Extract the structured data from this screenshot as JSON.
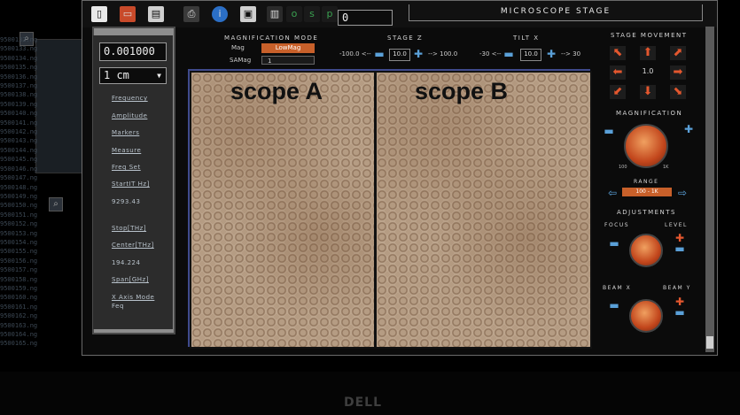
{
  "background": {
    "list_items": [
      "9500132.ng",
      "9500133.ng",
      "9500134.ng",
      "9500135.ng",
      "9500136.ng",
      "9500137.ng",
      "9500138.ng",
      "9500139.ng",
      "9500140.ng",
      "9500141.ng",
      "9500142.ng",
      "9500143.ng",
      "9500144.ng",
      "9500145.ng",
      "9500146.ng",
      "9500147.ng",
      "9500148.ng",
      "9500149.ng",
      "9500150.ng",
      "9500151.ng",
      "9500152.ng",
      "9500153.ng",
      "9500154.ng",
      "9500155.ng",
      "9500156.ng",
      "9500157.ng",
      "9500158.ng",
      "9500159.ng",
      "9500160.ng",
      "9500161.ng",
      "9500162.ng",
      "9500163.ng",
      "9500164.ng",
      "9500165.ng"
    ]
  },
  "toolbar": {
    "counter_value": "0",
    "stage_title": "MICROSCOPE STAGE",
    "magnification_mode_label": "MAGNIFICATION MODE",
    "mag_label": "Mag",
    "samag_label": "SAMag",
    "mode_value": "LowMag",
    "samag_value": "1",
    "stage_z_label": "STAGE Z",
    "stage_z_min": "-100.0 <--",
    "stage_z_value": "10.0",
    "stage_z_max": "--> 100.0",
    "tilt_x_label": "TILT X",
    "tilt_x_min": "-30 <--",
    "tilt_x_value": "10.0",
    "tilt_x_max": "--> 30"
  },
  "left_panel": {
    "value_field": "0.001000",
    "unit_select": "1 cm",
    "items": [
      {
        "label": "Frequency",
        "kind": "link"
      },
      {
        "label": "Amplitude",
        "kind": "link"
      },
      {
        "label": "Markers",
        "kind": "link"
      },
      {
        "label": "Measure",
        "kind": "link"
      },
      {
        "label": "Freq Set",
        "kind": "link"
      },
      {
        "label": "StartIT Hz]",
        "kind": "link"
      },
      {
        "label": "9293.43",
        "kind": "value"
      },
      {
        "label": "Stop[THz]",
        "kind": "link"
      },
      {
        "label": "Center[THz]",
        "kind": "link"
      },
      {
        "label": "194.224",
        "kind": "value"
      },
      {
        "label": "Span[GHz]",
        "kind": "link"
      },
      {
        "label": "X Axis Mode",
        "kind": "link"
      },
      {
        "label": "Feq",
        "kind": "value"
      }
    ]
  },
  "viewport": {
    "scope_a": "scope A",
    "scope_b": "scope B"
  },
  "right_panel": {
    "stage_movement_label": "STAGE MOVEMENT",
    "step_value": "1.0",
    "magnification_label": "MAGNIFICATION",
    "dial_min": "100",
    "dial_max": "1K",
    "range_label": "RANGE",
    "range_value": "100 - 1K",
    "adjustments_label": "ADJUSTMENTS",
    "focus_label": "FOCUS",
    "level_label": "LEVEL",
    "beam_x_label": "BEAM X",
    "beam_y_label": "BEAM Y"
  },
  "monitor": {
    "brand": "DELL"
  },
  "colors": {
    "accent_orange": "#e4572e",
    "accent_blue": "#5aa0d8",
    "panel_gray": "#8d8d8d"
  }
}
